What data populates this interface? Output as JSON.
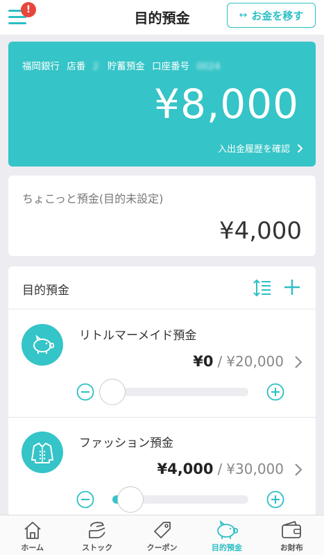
{
  "header": {
    "title": "目的預金",
    "badge": "!",
    "transfer_label": "お金を移す",
    "transfer_icon": "↔"
  },
  "account": {
    "bank": "福岡銀行",
    "branch_label": "店番",
    "branch_number": "2 ",
    "type": "貯蓄預金",
    "account_label": "口座番号",
    "account_number": "0024 ",
    "balance": "¥8,000",
    "history_link": "入出金履歴を確認"
  },
  "chokotto": {
    "label": "ちょこっと預金(目的未設定)",
    "amount": "¥4,000"
  },
  "goals": {
    "heading": "目的預金",
    "items": [
      {
        "name": "リトルマーメイド預金",
        "current": "¥0",
        "separator": "/",
        "target": "¥20,000",
        "progress": 0.0,
        "icon": "piggy-bank-icon"
      },
      {
        "name": "ファッション預金",
        "current": "¥4,000",
        "separator": "/",
        "target": "¥30,000",
        "progress": 0.133,
        "icon": "jacket-icon"
      }
    ]
  },
  "nav": {
    "items": [
      {
        "label": "ホーム",
        "icon": "home-icon"
      },
      {
        "label": "ストック",
        "icon": "stock-hand-icon"
      },
      {
        "label": "クーポン",
        "icon": "coupon-tag-icon"
      },
      {
        "label": "目的預金",
        "icon": "piggy-bank-icon"
      },
      {
        "label": "お財布",
        "icon": "wallet-icon"
      }
    ],
    "active_index": 3
  },
  "colors": {
    "accent": "#35c4c7",
    "badge": "#e8453c"
  }
}
